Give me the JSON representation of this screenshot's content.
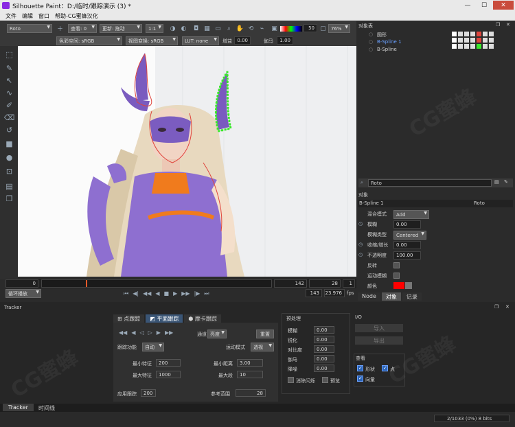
{
  "window": {
    "title": "Silhouette Paint：D:/临时/跟踪演示 (3) *"
  },
  "menu": [
    "文件",
    "编辑",
    "窗口",
    "帮助-CG蜜蜂汉化"
  ],
  "toolbar": {
    "mode": "Roto",
    "view_label": "查看: 0",
    "update_label": "更新: 拖动",
    "ratio": "1:1",
    "color_num": "50",
    "zoom": "76%",
    "colorspace": "色彩空间: sRGB",
    "viewtransform": "视图变换: sRGB",
    "lut": "LUT: none",
    "gain_label": "增益",
    "gain_value": "0.00",
    "gamma_label": "伽马",
    "gamma_value": "1.00"
  },
  "objects_panel": {
    "title": "对象表",
    "items": [
      {
        "name": "圆形",
        "selected": false
      },
      {
        "name": "B-Spline 1",
        "selected": true
      },
      {
        "name": "B-Spline",
        "selected": false
      }
    ]
  },
  "node_field": "Roto",
  "properties": {
    "title": "对象",
    "object_name": "B-Spline 1",
    "node_name": "Roto",
    "rows": [
      {
        "label": "混合模式",
        "value": "Add"
      },
      {
        "label": "模糊",
        "value": "0.00"
      },
      {
        "label": "模糊类型",
        "value": "Centered"
      },
      {
        "label": "收缩/增长",
        "value": "0.00"
      },
      {
        "label": "不透明度",
        "value": "100.00"
      },
      {
        "label": "反转",
        "value": ""
      },
      {
        "label": "运动模糊",
        "value": ""
      },
      {
        "label": "颜色",
        "value": ""
      }
    ],
    "tabs": [
      "Node",
      "对象",
      "记录"
    ]
  },
  "timeline": {
    "start": "0",
    "current": "142",
    "end": "28",
    "step": "1",
    "loop_label": "循环播放",
    "frames": "143",
    "fps": "23.976",
    "fps_unit": "fps"
  },
  "tracker": {
    "title": "Tracker",
    "tabs": [
      "点跟踪",
      "平面跟踪",
      "摩卡跟踪"
    ],
    "channel_label": "通道",
    "channel_value": "亮度",
    "reset_label": "重置",
    "track_func_label": "跟踪功能",
    "track_func_value": "自动",
    "motion_label": "运动模式",
    "motion_value": "透视",
    "min_feature_label": "最小特征",
    "min_feature_value": "200",
    "min_dist_label": "最小距离",
    "min_dist_value": "3.00",
    "max_feature_label": "最大特征",
    "max_feature_value": "1000",
    "max_segment_label": "最大段",
    "max_segment_value": "10",
    "apply_label": "应用跟踪",
    "apply_value": "200",
    "ref_label": "参考范围",
    "ref_value": "28",
    "pre_title": "预处理",
    "pre_rows": [
      {
        "label": "模糊",
        "value": "0.00"
      },
      {
        "label": "锐化",
        "value": "0.00"
      },
      {
        "label": "对比度",
        "value": "0.00"
      },
      {
        "label": "伽马",
        "value": "0.00"
      },
      {
        "label": "降噪",
        "value": "0.00"
      }
    ],
    "flicker_label": "消除闪烁",
    "preview_label": "预览",
    "io_title": "I/O",
    "import_label": "导入",
    "export_label": "导出",
    "view_title": "查看",
    "shape_label": "形状",
    "point_label": "点",
    "vector_label": "向量"
  },
  "bottom_tabs": [
    "Tracker",
    "时间线"
  ],
  "status": "2/1033 (0%) 8 bits",
  "watermark": "CG蜜蜂",
  "colors": {
    "spline_red": "#e0443c",
    "spline_green": "#39e82a",
    "accent": "#2a64b8",
    "swatch": "#ff0000"
  }
}
